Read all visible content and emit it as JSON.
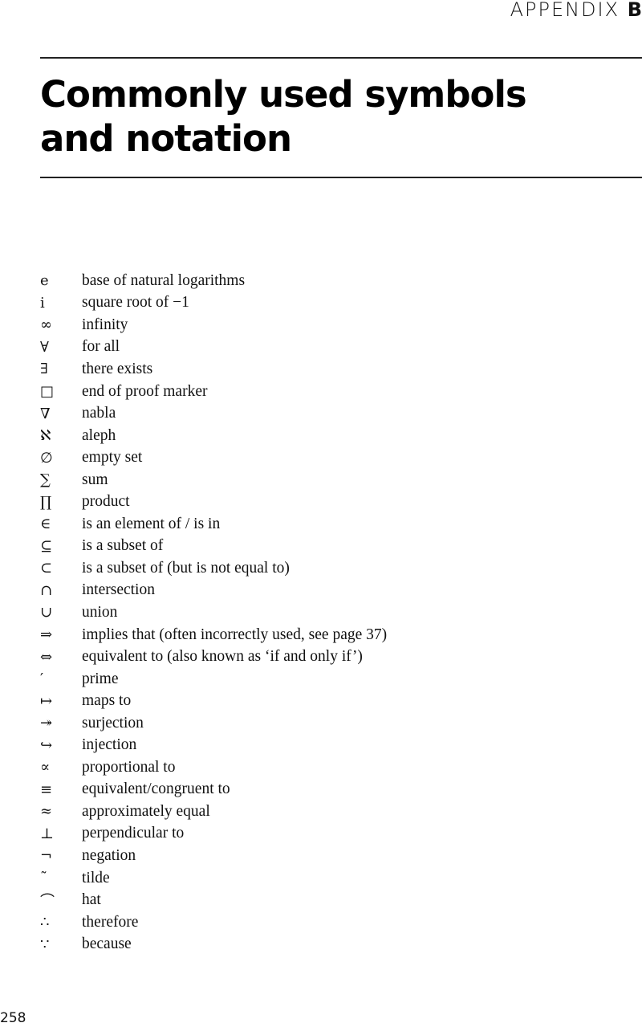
{
  "running_head": {
    "label": "APPENDIX",
    "letter": "B"
  },
  "title": {
    "line1": "Commonly used symbols",
    "line2": "and notation"
  },
  "symbols": [
    {
      "symbol": "e",
      "icon": "euler-number-symbol",
      "description": "base of natural logarithms"
    },
    {
      "symbol": "i",
      "icon": "imaginary-unit-symbol",
      "description": "square root of −1"
    },
    {
      "symbol": "∞",
      "icon": "infinity-symbol",
      "description": "infinity"
    },
    {
      "symbol": "∀",
      "icon": "for-all-symbol",
      "description": "for all"
    },
    {
      "symbol": "∃",
      "icon": "exists-symbol",
      "description": "there exists"
    },
    {
      "symbol": "□",
      "icon": "end-of-proof-symbol",
      "description": "end of proof marker"
    },
    {
      "symbol": "∇",
      "icon": "nabla-symbol",
      "description": "nabla"
    },
    {
      "symbol": "ℵ",
      "icon": "aleph-symbol",
      "description": "aleph"
    },
    {
      "symbol": "∅",
      "icon": "empty-set-symbol",
      "description": "empty set"
    },
    {
      "symbol": "∑",
      "icon": "sum-symbol",
      "description": "sum"
    },
    {
      "symbol": "∏",
      "icon": "product-symbol",
      "description": "product"
    },
    {
      "symbol": "∈",
      "icon": "element-of-symbol",
      "description": "is an element of / is in"
    },
    {
      "symbol": "⊆",
      "icon": "subset-or-equal-symbol",
      "description": "is a subset of"
    },
    {
      "symbol": "⊂",
      "icon": "proper-subset-symbol",
      "description": "is a subset of (but is not equal to)"
    },
    {
      "symbol": "∩",
      "icon": "intersection-symbol",
      "description": "intersection"
    },
    {
      "symbol": "∪",
      "icon": "union-symbol",
      "description": "union"
    },
    {
      "symbol": "⇒",
      "icon": "implies-symbol",
      "description": "implies that (often incorrectly used, see page 37)"
    },
    {
      "symbol": "⇔",
      "icon": "equivalent-symbol",
      "description": "equivalent to (also known as ‘if and only if’)"
    },
    {
      "symbol": "′",
      "icon": "prime-symbol",
      "description": "prime"
    },
    {
      "symbol": "↦",
      "icon": "maps-to-symbol",
      "description": "maps to"
    },
    {
      "symbol": "↠",
      "icon": "surjection-symbol",
      "description": "surjection"
    },
    {
      "symbol": "↪",
      "icon": "injection-symbol",
      "description": "injection"
    },
    {
      "symbol": "∝",
      "icon": "proportional-symbol",
      "description": "proportional to"
    },
    {
      "symbol": "≡",
      "icon": "congruent-symbol",
      "description": "equivalent/congruent to"
    },
    {
      "symbol": "≈",
      "icon": "approximately-equal-symbol",
      "description": "approximately equal"
    },
    {
      "symbol": "⊥",
      "icon": "perpendicular-symbol",
      "description": "perpendicular to"
    },
    {
      "symbol": "¬",
      "icon": "negation-symbol",
      "description": "negation"
    },
    {
      "symbol": "˜",
      "icon": "tilde-symbol",
      "description": "tilde"
    },
    {
      "symbol": "⌒",
      "icon": "hat-symbol",
      "description": "hat"
    },
    {
      "symbol": "∴",
      "icon": "therefore-symbol",
      "description": "therefore"
    },
    {
      "symbol": "∵",
      "icon": "because-symbol",
      "description": "because"
    }
  ],
  "page_number": "258"
}
